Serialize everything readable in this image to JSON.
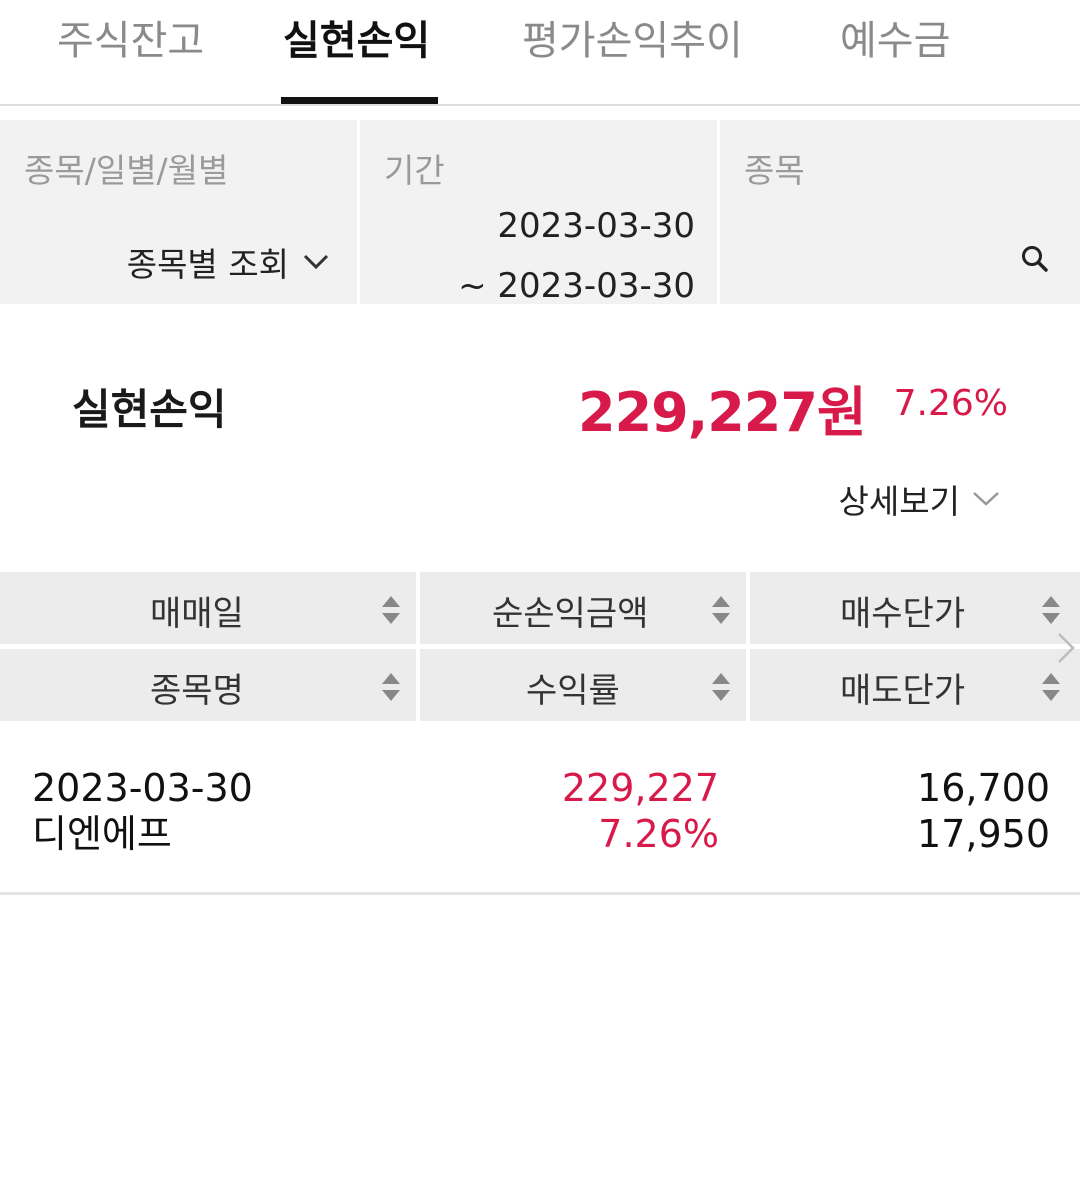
{
  "tabs": [
    {
      "label": "주식잔고",
      "active": false
    },
    {
      "label": "실현손익",
      "active": true
    },
    {
      "label": "평가손익추이",
      "active": false
    },
    {
      "label": "예수금",
      "active": false
    }
  ],
  "filters": {
    "type": {
      "label": "종목/일별/월별",
      "value": "종목별 조회",
      "icon": "chevron-down-icon"
    },
    "period": {
      "label": "기간",
      "start": "2023-03-30",
      "end": "~ 2023-03-30"
    },
    "stock": {
      "label": "종목",
      "value": "",
      "icon": "search-icon"
    }
  },
  "summary": {
    "label": "실현손익",
    "amount": "229,227원",
    "rate": "7.26%",
    "detail_label": "상세보기"
  },
  "table": {
    "headers_row1": [
      "매매일",
      "순손익금액",
      "매수단가"
    ],
    "headers_row2": [
      "종목명",
      "수익률",
      "매도단가"
    ],
    "rows": [
      {
        "date": "2023-03-30",
        "name": "디엔에프",
        "profit": "229,227",
        "rate": "7.26%",
        "buy_price": "16,700",
        "sell_price": "17,950"
      }
    ]
  },
  "colors": {
    "accent_red": "#d81a4a",
    "header_bg": "#ececec",
    "filter_bg": "#f2f2f2"
  }
}
